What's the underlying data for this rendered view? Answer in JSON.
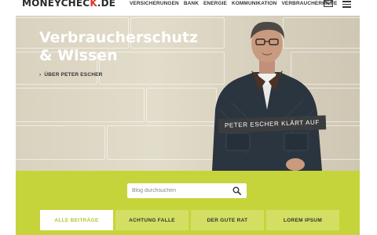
{
  "header": {
    "logo_text": "MONEYCHEC",
    "logo_accent": "K",
    "logo_suffix": ".DE",
    "nav": [
      "VERSICHERUNGEN",
      "BANK",
      "ENERGIE",
      "KOMMUNIKATION",
      "VERBRAUCHERHILFE"
    ],
    "mail_icon": "envelope-icon",
    "menu_icon": "hamburger-menu-icon"
  },
  "hero": {
    "title_line1": "Verbraucherschutz",
    "title_line2": "& Wissen",
    "link": "ÜBER PETER ESCHER",
    "badge": "PETER ESCHER KLÄRT AUF"
  },
  "search": {
    "placeholder": "Blog durchsuchen",
    "icon": "search-icon"
  },
  "tabs": [
    {
      "label": "ALLE BEITRÄGE",
      "active": true
    },
    {
      "label": "ACHTUNG FALLE",
      "active": false
    },
    {
      "label": "DER GUTE RAT",
      "active": false
    },
    {
      "label": "LOREM IPSUM",
      "active": false
    }
  ],
  "colors": {
    "accent_red": "#e0302b",
    "lime_band": "#c6d43b",
    "lime_tab": "#d3df62",
    "active_tab_text": "#b7c32c",
    "badge_bg": "#3a3c3d"
  }
}
